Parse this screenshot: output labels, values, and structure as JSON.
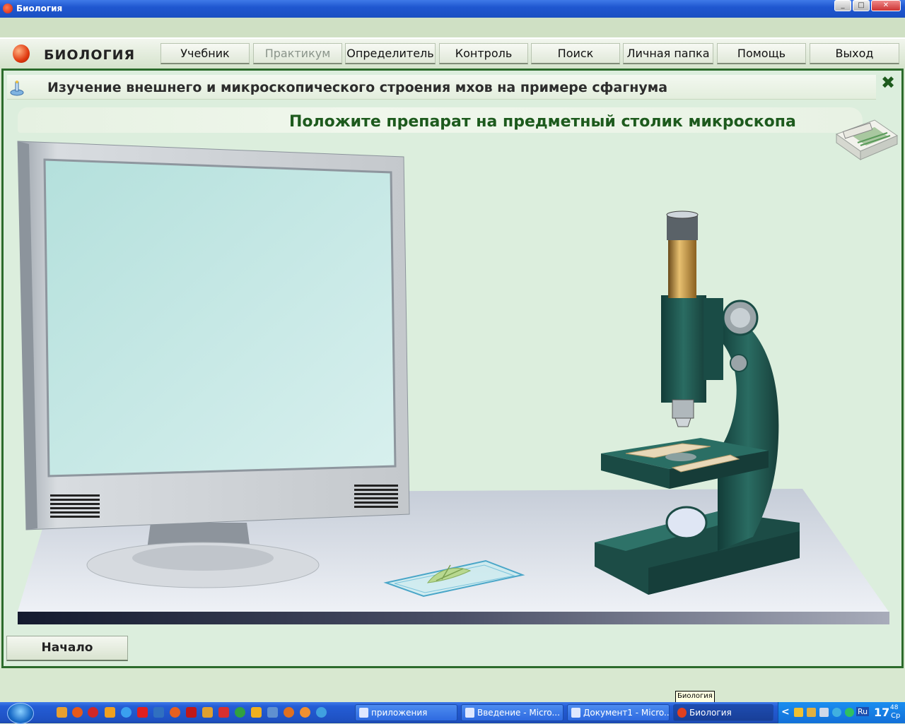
{
  "window": {
    "title": "Биология"
  },
  "app": {
    "brand": "БИОЛОГИЯ"
  },
  "menu": {
    "items": [
      {
        "label": "Учебник",
        "disabled": false
      },
      {
        "label": "Практикум",
        "disabled": true
      },
      {
        "label": "Определитель",
        "disabled": false
      },
      {
        "label": "Контроль",
        "disabled": false
      },
      {
        "label": "Поиск",
        "disabled": false
      },
      {
        "label": "Личная папка",
        "disabled": false
      },
      {
        "label": "Помощь",
        "disabled": false
      },
      {
        "label": "Выход",
        "disabled": false
      }
    ]
  },
  "lesson": {
    "title": "Изучение внешнего и микроскопического строения мхов на примере сфагнума",
    "instruction": "Положите препарат на предметный столик микроскопа"
  },
  "controls": {
    "start_label": "Начало"
  },
  "tooltip": "Биология",
  "taskbar": {
    "tasks": [
      {
        "label": "приложения",
        "active": false
      },
      {
        "label": "Введение - Micro...",
        "active": false
      },
      {
        "label": "Документ1 - Micro...",
        "active": false
      },
      {
        "label": "Биология",
        "active": true
      }
    ],
    "lang": "Ru",
    "clock_hour": "17",
    "clock_min": "48",
    "clock_day": "Ср"
  },
  "colors": {
    "accent": "#1d5a1d",
    "panel_border": "#2c6b2c",
    "microscope": "#1f5a52"
  }
}
